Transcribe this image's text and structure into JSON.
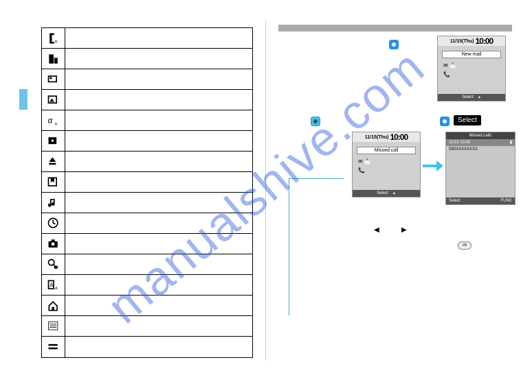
{
  "watermark": "manualshive.com",
  "icons_alt": [
    "phone-mode-icon",
    "building-icon",
    "card-icon",
    "picture-icon",
    "alpha-icon",
    "photo-icon",
    "eject-icon",
    "bookmark-icon",
    "music-icon",
    "clock-icon",
    "camera-icon",
    "dict-icon",
    "char-icon",
    "home-icon",
    "list-icon",
    "equal-icon"
  ],
  "phone_newmail": {
    "date": "11/15(Thu)",
    "time": "10:00",
    "label": "New mail",
    "soft_center": "Select"
  },
  "phone_missed": {
    "date": "11/15(Thu)",
    "time": "10:00",
    "label": "Missed call",
    "soft_center": "Select"
  },
  "phone_list": {
    "title": "Missed calls",
    "row_date": "11/15 10:00",
    "row_num": "090XXXXXXXX",
    "soft_left": "Select",
    "soft_right": "FUNC"
  },
  "select_label": "Select",
  "key_label": "ch"
}
